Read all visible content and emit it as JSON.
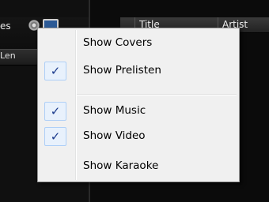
{
  "background": {
    "left_text": "es",
    "left_bar_text": "Len",
    "columns": [
      "Title",
      "Artist"
    ]
  },
  "menu": {
    "items": [
      {
        "label": "Show Covers",
        "checked": false,
        "check": "✓"
      },
      {
        "label": "Show Prelisten",
        "checked": true,
        "check": "✓"
      },
      {
        "label": "Show Music",
        "checked": true,
        "check": "✓"
      },
      {
        "label": "Show Video",
        "checked": true,
        "check": "✓"
      },
      {
        "label": "Show Karaoke",
        "checked": false,
        "check": "✓"
      }
    ]
  },
  "colors": {
    "check_glyph": "#1a3a8c",
    "check_box_border": "#aecff7",
    "menu_background": "#f0f0f0"
  }
}
